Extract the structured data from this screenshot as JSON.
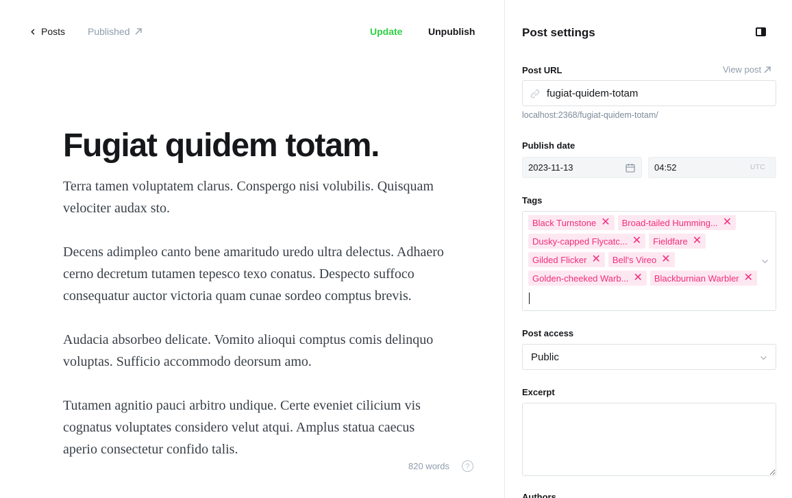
{
  "header": {
    "back_label": "Posts",
    "status_label": "Published",
    "update_label": "Update",
    "unpublish_label": "Unpublish"
  },
  "editor": {
    "title": "Fugiat quidem totam.",
    "paragraphs": [
      "Terra tamen voluptatem clarus. Conspergo nisi volubilis. Quisquam velociter audax sto.",
      "Decens adimpleo canto bene amaritudo uredo ultra delectus. Adhaero cerno decretum tutamen tepesco texo conatus. Despecto suffoco consequatur auctor victoria quam cunae sordeo comptus brevis.",
      "Audacia absorbeo delicate. Vomito alioqui comptus comis delinquo voluptas. Sufficio accommodo deorsum amo.",
      "Tutamen agnitio pauci arbitro undique. Certe eveniet cilicium vis cognatus voluptates considero velut atqui. Amplus statua caecus aperio consectetur confido talis."
    ],
    "word_count": "820 words",
    "help_glyph": "?"
  },
  "settings": {
    "title": "Post settings",
    "post_url": {
      "label": "Post URL",
      "view_post_label": "View post",
      "value": "fugiat-quidem-totam",
      "hint": "localhost:2368/fugiat-quidem-totam/"
    },
    "publish_date": {
      "label": "Publish date",
      "date": "2023-11-13",
      "time": "04:52",
      "timezone": "UTC"
    },
    "tags": {
      "label": "Tags",
      "items": [
        "Black Turnstone",
        "Broad-tailed Humming...",
        "Dusky-capped Flycatc...",
        "Fieldfare",
        "Gilded Flicker",
        "Bell's Vireo",
        "Golden-cheeked Warb...",
        "Blackburnian Warbler"
      ],
      "remove_glyph": "✕"
    },
    "post_access": {
      "label": "Post access",
      "value": "Public"
    },
    "excerpt": {
      "label": "Excerpt",
      "value": ""
    },
    "authors": {
      "label": "Authors"
    }
  },
  "colors": {
    "accent_green": "#30cf43",
    "tag_pink": "#f12c7d",
    "tag_bg": "#fde8f1"
  }
}
